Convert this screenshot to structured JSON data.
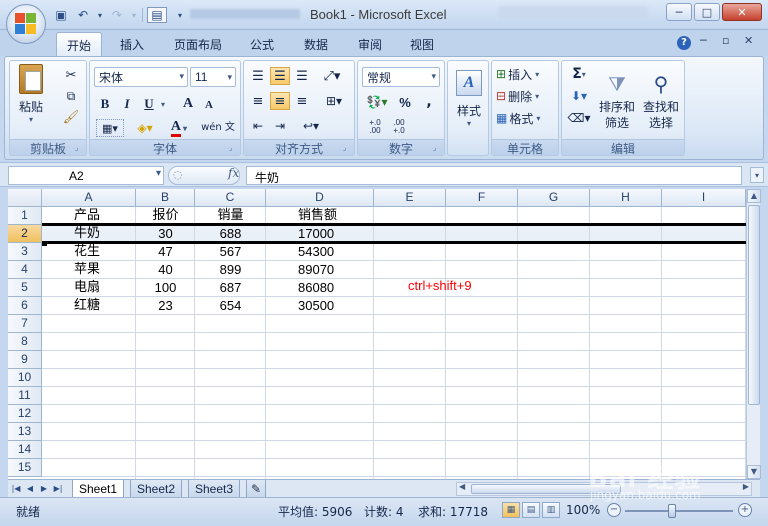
{
  "window": {
    "title": "Book1 - Microsoft Excel",
    "buttons": [
      "─",
      "□",
      "✕"
    ]
  },
  "tabs": [
    "开始",
    "插入",
    "页面布局",
    "公式",
    "数据",
    "审阅",
    "视图"
  ],
  "doc_controls": [
    "─",
    "▫",
    "✕"
  ],
  "ribbon": {
    "clipboard": {
      "paste": "粘贴",
      "label": "剪贴板"
    },
    "font": {
      "name": "宋体",
      "size": "11",
      "bold": "B",
      "italic": "I",
      "underline": "U",
      "grow": "A",
      "shrink": "A",
      "color_letter": "A",
      "phonetic": "wén 文",
      "label": "字体"
    },
    "alignment": {
      "label": "对齐方式"
    },
    "number": {
      "format": "常规",
      "percent": "%",
      "comma": ",",
      "inc_decimal": "+.0 .00",
      "dec_decimal": ".00 +.0",
      "label": "数字"
    },
    "styles": {
      "label": "样式"
    },
    "cells": {
      "insert": "插入",
      "delete": "删除",
      "format": "格式",
      "label": "单元格"
    },
    "editing": {
      "sigma": "Σ",
      "sort": "排序和\n筛选",
      "find": "查找和\n选择",
      "label": "编辑"
    }
  },
  "formula_bar": {
    "name_box": "A2",
    "fx": "fx",
    "value": "牛奶"
  },
  "sheet": {
    "columns": [
      "A",
      "B",
      "C",
      "D",
      "E",
      "F",
      "G",
      "H",
      "I"
    ],
    "selected_row": 2,
    "rows": [
      "1",
      "2",
      "3",
      "4",
      "5",
      "6",
      "7",
      "8",
      "9",
      "10",
      "11",
      "12",
      "13",
      "14",
      "15"
    ],
    "data": [
      [
        "产品",
        "报价",
        "销量",
        "销售额"
      ],
      [
        "牛奶",
        "30",
        "688",
        "17000"
      ],
      [
        "花生",
        "47",
        "567",
        "54300"
      ],
      [
        "苹果",
        "40",
        "899",
        "89070"
      ],
      [
        "电扇",
        "100",
        "687",
        "86080"
      ],
      [
        "红糖",
        "23",
        "654",
        "30500"
      ]
    ],
    "note": "ctrl+shift+9"
  },
  "sheet_tabs": [
    "Sheet1",
    "Sheet2",
    "Sheet3"
  ],
  "status": {
    "ready": "就绪",
    "average": "平均值: 5906",
    "count": "计数: 4",
    "sum": "求和: 17718",
    "zoom": "100%"
  },
  "watermark": {
    "main": "Bai 经验",
    "sub": "jingyan.baidu.com"
  }
}
